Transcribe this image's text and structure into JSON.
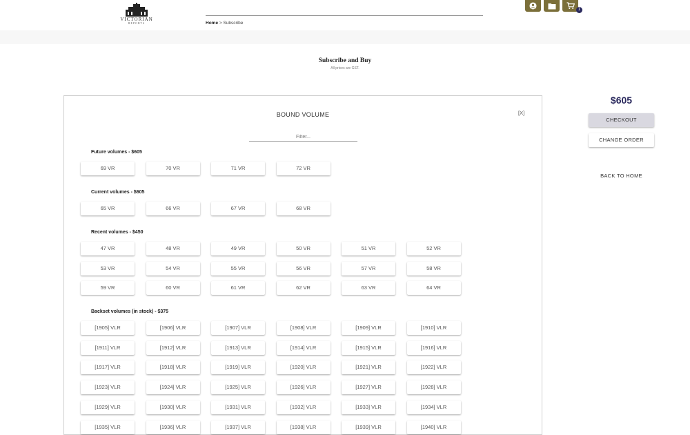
{
  "header": {
    "logo_text": "VICTORIAN",
    "logo_subtext": "REPORTS",
    "breadcrumb": {
      "home": "Home",
      "separator": " > ",
      "current": "Subscribe"
    },
    "cart_count": "1",
    "icons": [
      "account-icon",
      "folder-icon",
      "cart-icon"
    ]
  },
  "page": {
    "title": "Subscribe and Buy",
    "subtitle": "All prices are GST."
  },
  "panel": {
    "title": "BOUND VOLUME",
    "close_label": "[X]",
    "filter_placeholder": "Filter..."
  },
  "sections": [
    {
      "heading": "Future volumes - $605",
      "rows": [
        [
          "69 VR",
          "70 VR",
          "71 VR",
          "72 VR"
        ]
      ]
    },
    {
      "heading": "Current volumes - $605",
      "rows": [
        [
          "65 VR",
          "66 VR",
          "67 VR",
          "68 VR"
        ]
      ]
    },
    {
      "heading": "Recent volumes - $450",
      "rows": [
        [
          "47 VR",
          "48 VR",
          "49 VR",
          "50 VR",
          "51 VR",
          "52 VR"
        ],
        [
          "53 VR",
          "54 VR",
          "55 VR",
          "56 VR",
          "57 VR",
          "58 VR"
        ],
        [
          "59 VR",
          "60 VR",
          "61 VR",
          "62 VR",
          "63 VR",
          "64 VR"
        ]
      ]
    },
    {
      "heading": "Backset volumes (in stock) - $375",
      "rows": [
        [
          "[1905] VLR",
          "[1906] VLR",
          "[1907] VLR",
          "[1908] VLR",
          "[1909] VLR",
          "[1910] VLR"
        ],
        [
          "[1911] VLR",
          "[1912] VLR",
          "[1913] VLR",
          "[1914] VLR",
          "[1915] VLR",
          "[1916] VLR"
        ],
        [
          "[1917] VLR",
          "[1918] VLR",
          "[1919] VLR",
          "[1920] VLR",
          "[1921] VLR",
          "[1922] VLR"
        ],
        [
          "[1923] VLR",
          "[1924] VLR",
          "[1925] VLR",
          "[1926] VLR",
          "[1927] VLR",
          "[1928] VLR"
        ],
        [
          "[1929] VLR",
          "[1930] VLR",
          "[1931] VLR",
          "[1932] VLR",
          "[1933] VLR",
          "[1934] VLR"
        ],
        [
          "[1935] VLR",
          "[1936] VLR",
          "[1937] VLR",
          "[1938] VLR",
          "[1939] VLR",
          "[1940] VLR"
        ]
      ]
    }
  ],
  "sidebar": {
    "price": "$605",
    "checkout_label": "CHECKOUT",
    "change_order_label": "CHANGE ORDER",
    "back_home_label": "BACK TO HOME"
  },
  "colors": {
    "brand_gold": "#7b6f3a",
    "accent_navy": "#2b2a5e",
    "checkout_bg": "#d9d8e0"
  }
}
